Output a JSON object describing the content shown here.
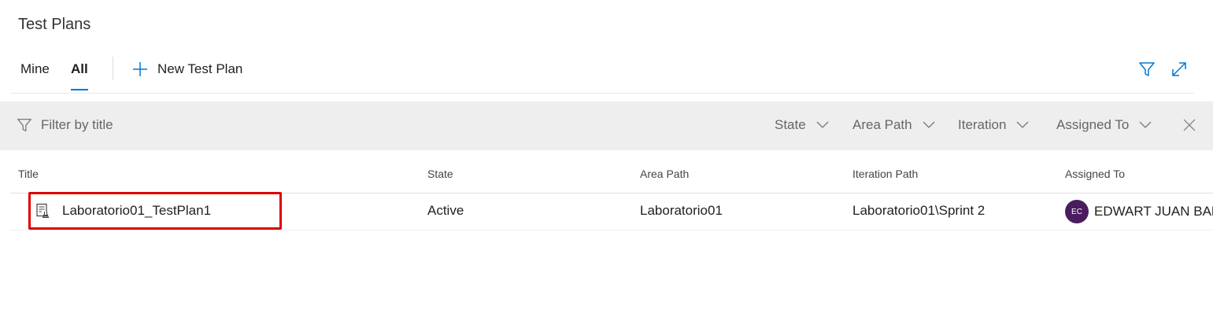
{
  "page": {
    "title": "Test Plans"
  },
  "pivot": {
    "tabs": [
      {
        "label": "Mine",
        "selected": false
      },
      {
        "label": "All",
        "selected": true
      }
    ],
    "new_plan_label": "New Test Plan",
    "icons": [
      "plus-icon",
      "filter-icon",
      "expand-icon"
    ]
  },
  "filter_bar": {
    "placeholder": "Filter by title",
    "dropdowns": [
      "State",
      "Area Path",
      "Iteration",
      "Assigned To"
    ]
  },
  "grid": {
    "columns": [
      "Title",
      "State",
      "Area Path",
      "Iteration Path",
      "Assigned To"
    ],
    "rows": [
      {
        "title": "Laboratorio01_TestPlan1",
        "state": "Active",
        "area_path": "Laboratorio01",
        "iteration_path": "Laboratorio01\\Sprint 2",
        "assigned_to": "EDWART JUAN BALC",
        "avatar_initials": "EC"
      }
    ]
  },
  "colors": {
    "accent": "#0078d4",
    "highlight": "#e00000",
    "avatar_bg": "#4a1d5e",
    "filter_bar_bg": "#eeeeee"
  }
}
